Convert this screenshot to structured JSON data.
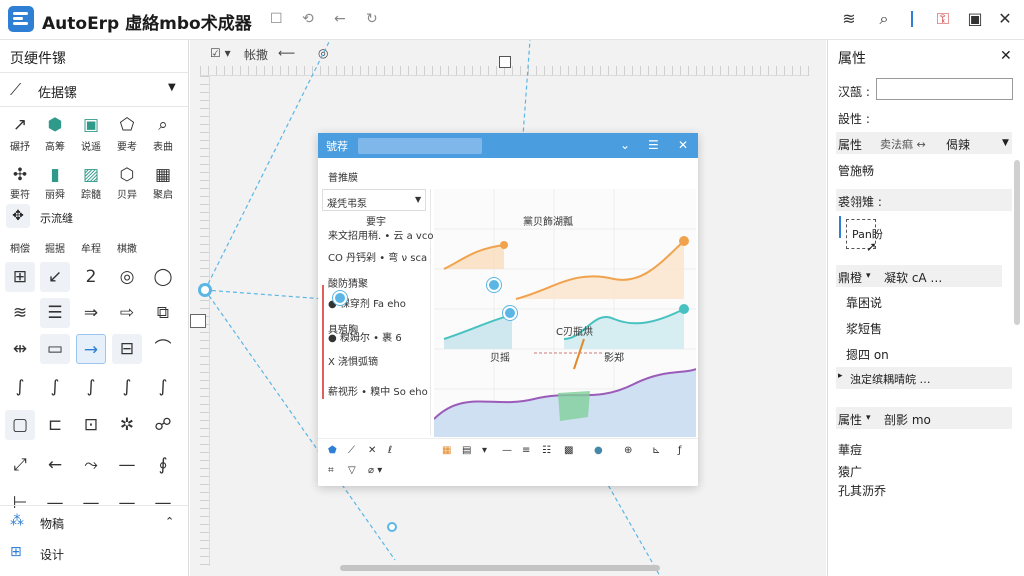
{
  "app": {
    "title": "AutoErp 虛絡mbo术成器"
  },
  "left_panel": {
    "header": "页绠件镙",
    "section_label": "佐据镙",
    "sample_label": "示流缝",
    "rows_labels": [
      [
        "碾抒",
        "高筹",
        "说遥",
        "要考",
        "表曲"
      ],
      [
        "要符",
        "丽舜",
        "踪髓",
        "贝异",
        "聚启"
      ],
      [
        "桐偿",
        "掘据",
        "牟程",
        "棋撒",
        ""
      ]
    ],
    "tools": [
      [
        "↗",
        "⬢",
        "▣",
        "⬠",
        "⌕"
      ],
      [
        "✣",
        "▮",
        "▨",
        "⬡",
        "▦"
      ],
      [
        "⊞",
        "↙",
        "2",
        "◎",
        "◯"
      ],
      [
        "≋",
        "☰",
        "⇒",
        "⇨",
        "⧉"
      ],
      [
        "⇹",
        "▭",
        "→",
        "⊟",
        "⌒"
      ],
      [
        "∫",
        "∫",
        "∫",
        "∫",
        "∫"
      ],
      [
        "▢",
        "⊏",
        "⊡",
        "✲",
        "☍"
      ],
      [
        "⤢",
        "←",
        "⤳",
        "—",
        "∮"
      ],
      [
        "⊢",
        "—",
        "—",
        "—",
        "—"
      ]
    ],
    "footer_section": "物稿",
    "footer_item": "设计"
  },
  "canvas_toolbar": {
    "label": "帐撒"
  },
  "dialog": {
    "tab_label": "號荐",
    "subtitle": "普推膜",
    "dropdown": "凝凭弔泵",
    "list_items": [
      "要宇",
      "来文招用稍. • 云 a vco",
      "CO 丹钙剁 • 弯 ν sca",
      "酸防猜聚",
      "● 棵穿剂 Fa eho",
      "具殖胸",
      "● 糗姆尔 • 裹 6",
      "X 浇惧弧镝",
      "薪视形 • 糗中 So eho"
    ],
    "chart_caption": "黨贝飾湖瓢",
    "chart_note": "C刃瓶烘",
    "arrow_left": "贝摇",
    "arrow_right": "影郑"
  },
  "right_panel": {
    "title": "属性",
    "name_label": "汉瓿 :",
    "name_value": "",
    "status_label": "設性 :",
    "prop_label": "属性",
    "prop_value": "卖法痲 ↔",
    "prop_alt": "偈辣",
    "section1": "管施畅",
    "box_label": "裘翎雉 :",
    "box_text": "Pan盼",
    "group_label": "鼎橙",
    "group_value": "凝软 cA …",
    "items": [
      "靠困说",
      "浆短售",
      "摁四 on"
    ],
    "expand": "浊定缤耦晴皖 …",
    "group2_label": "属性",
    "group2_value": "剖影 mo",
    "footer": [
      "華痘",
      "猿广",
      "孔其沥乔"
    ]
  },
  "colors": {
    "accent": "#2f7fd4",
    "dialog_title": "#4a9ee0",
    "guide": "#5bb6e6",
    "chart_orange": "#f0a24c",
    "chart_teal": "#48c2c0",
    "chart_purple": "#9b5bb8"
  }
}
